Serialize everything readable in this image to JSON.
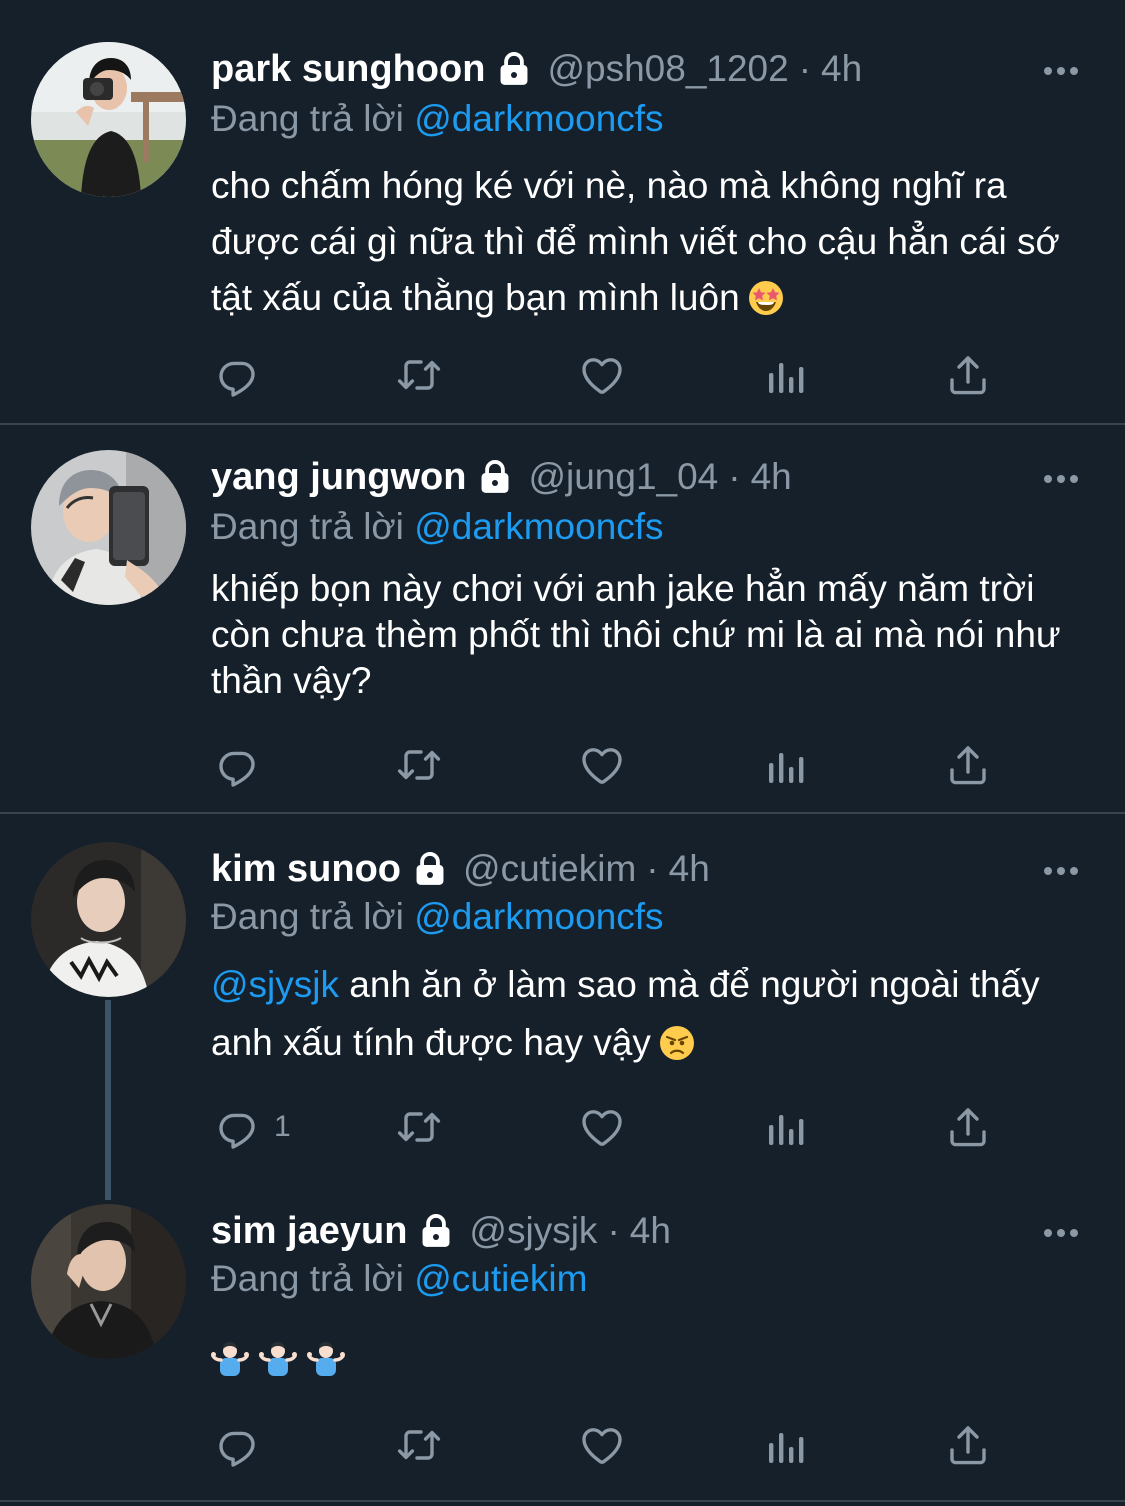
{
  "tweets": [
    {
      "name": "park sunghoon",
      "handle": "@psh08_1202",
      "dot": "·",
      "time": "4h",
      "replying_prefix": "Đang trả lời",
      "replying_to": "@darkmooncfs",
      "text": "cho chấm hóng ké với nè, nào mà không nghĩ ra được cái gì nữa thì để mình viết cho cậu hẳn cái sớ tật xấu của thằng bạn mình luôn",
      "emoji": "star-struck-emoji",
      "reply_count": ""
    },
    {
      "name": "yang jungwon",
      "handle": "@jung1_04",
      "dot": "·",
      "time": "4h",
      "replying_prefix": "Đang trả lời",
      "replying_to": "@darkmooncfs",
      "text": "khiếp bọn này chơi với anh jake hẳn mấy năm trời còn chưa thèm phốt thì thôi chứ mi là ai mà nói như thần vậy?",
      "reply_count": ""
    },
    {
      "name": "kim sunoo",
      "handle": "@cutiekim",
      "dot": "·",
      "time": "4h",
      "replying_prefix": "Đang trả lời",
      "replying_to": "@darkmooncfs",
      "text_mention": "@sjysjk",
      "text": " anh ăn ở làm sao mà để người ngoài thấy anh xấu tính được hay vậy",
      "emoji": "angry-face-emoji",
      "reply_count": "1"
    },
    {
      "name": "sim jaeyun",
      "handle": "@sjysjk",
      "dot": "·",
      "time": "4h",
      "replying_prefix": "Đang trả lời",
      "replying_to": "@cutiekim",
      "emojis": [
        "person-shrugging-emoji",
        "person-shrugging-emoji",
        "person-shrugging-emoji"
      ],
      "reply_count": ""
    }
  ],
  "icons": {
    "lock": "lock-icon",
    "more": "more-options-icon",
    "reply": "reply-icon",
    "retweet": "retweet-icon",
    "like": "heart-icon",
    "analytics": "analytics-icon",
    "share": "share-icon"
  },
  "colors": {
    "background": "#15202b",
    "divider": "#38444d",
    "text": "#ffffff",
    "secondary": "#8b98a5",
    "link": "#1d9bf0"
  }
}
